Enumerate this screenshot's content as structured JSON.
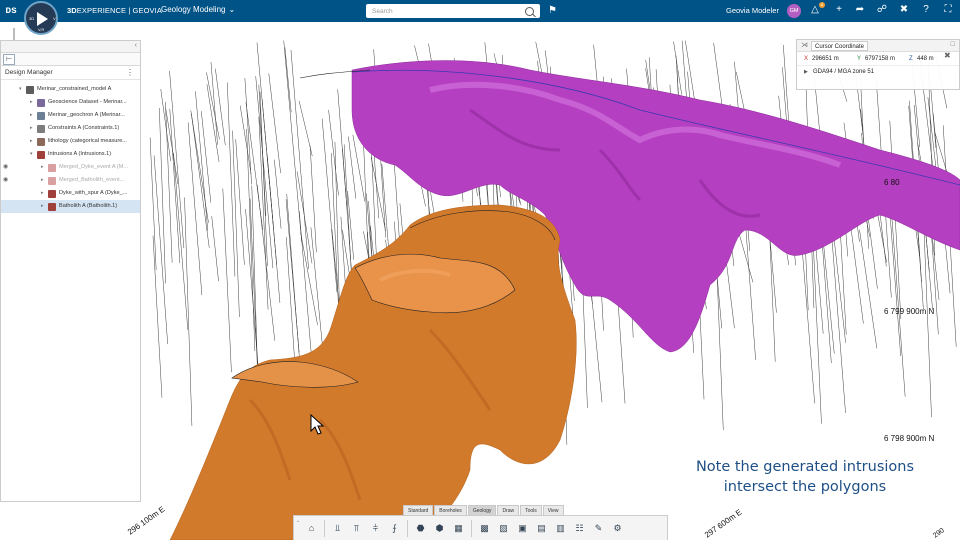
{
  "topbar": {
    "brand_bold": "3D",
    "brand_rest": "EXPERIENCE | GEOVIA",
    "app_title": "Geology Modeling",
    "search_placeholder": "Search",
    "user_name": "Geovia Modeler",
    "avatar_initials": "GM",
    "notification_count": "8",
    "compass_labels": {
      "left": "3D",
      "right": "V",
      "bottom": "V,R"
    },
    "icons": [
      "tag-icon",
      "notifications-icon",
      "add-icon",
      "share-icon",
      "network-icon",
      "tools-icon",
      "help-icon",
      "fullscreen-icon"
    ]
  },
  "left_panel": {
    "title": "Design Manager",
    "items": [
      {
        "label": "Merinar_constrained_model A",
        "level": 0,
        "expanded": true,
        "icon": "model-icon",
        "color": "#5c5c5c",
        "visibility": false,
        "dim": false,
        "selected": false
      },
      {
        "label": "Geoscience Dataset - Merinar...",
        "level": 1,
        "expanded": false,
        "icon": "dataset-icon",
        "color": "#7a6a9c",
        "visibility": false,
        "dim": false,
        "selected": false
      },
      {
        "label": "Merinar_geochron A (Merinar...",
        "level": 1,
        "expanded": false,
        "icon": "geochron-icon",
        "color": "#6d7f94",
        "visibility": false,
        "dim": false,
        "selected": false
      },
      {
        "label": "Constraints A (Constraints.1)",
        "level": 1,
        "expanded": false,
        "icon": "constraints-icon",
        "color": "#7d7d7d",
        "visibility": false,
        "dim": false,
        "selected": false
      },
      {
        "label": "lithology (categorical measure...",
        "level": 1,
        "expanded": false,
        "icon": "lithology-icon",
        "color": "#8c6a5a",
        "visibility": false,
        "dim": false,
        "selected": false
      },
      {
        "label": "Intrusions A (Intrusions.1)",
        "level": 1,
        "expanded": true,
        "icon": "intrusions-icon",
        "color": "#a0403a",
        "visibility": false,
        "dim": false,
        "selected": false
      },
      {
        "label": "Merged_Dyke_event A (M...",
        "level": 2,
        "expanded": false,
        "icon": "event-icon",
        "color": "#d8a0a0",
        "visibility": true,
        "dim": true,
        "selected": false
      },
      {
        "label": "Merged_Batholith_event...",
        "level": 2,
        "expanded": false,
        "icon": "event-icon",
        "color": "#d8a0a0",
        "visibility": true,
        "dim": true,
        "selected": false
      },
      {
        "label": "Dyke_with_spur A (Dyke_...",
        "level": 2,
        "expanded": false,
        "icon": "dyke-icon",
        "color": "#a0403a",
        "visibility": false,
        "dim": false,
        "selected": false
      },
      {
        "label": "Batholith A (Batholith.1)",
        "level": 2,
        "expanded": false,
        "icon": "batholith-icon",
        "color": "#a0403a",
        "visibility": false,
        "dim": false,
        "selected": true
      }
    ]
  },
  "cursor_panel": {
    "title": "Cursor Coordinate",
    "x_label": "X",
    "x_value": "296651 m",
    "y_label": "Y",
    "y_value": "6797158 m",
    "z_label": "Z",
    "z_value": "448 m",
    "crs": "GDA94 / MGA zone 51"
  },
  "viewport": {
    "labels": [
      "6 80",
      "6 799 900m N",
      "6 798 900m N",
      "296 100m E",
      "297 600m E",
      "290"
    ],
    "caption_line1": "Note the generated intrusions",
    "caption_line2": "intersect the polygons",
    "colors": {
      "intrusion_orange": "#d27a2c",
      "intrusion_magenta": "#b43fc0",
      "polygon_line": "#1e3c8c"
    }
  },
  "toolbar": {
    "tabs": [
      "Standard",
      "Boreholes",
      "Geology",
      "Draw",
      "Tools",
      "View"
    ],
    "active_tab": "Geology",
    "buttons": [
      "home-icon",
      "borehole-icon",
      "borehole-edit-icon",
      "drillhole-icon",
      "section-icon",
      "intrusion-icon",
      "geology-surface-icon",
      "block-model-icon",
      "volume-icon",
      "grid-icon",
      "cube-icon",
      "cube-shaded-icon",
      "surface-map-icon",
      "table-icon",
      "pen-icon",
      "settings-cube-icon"
    ]
  }
}
